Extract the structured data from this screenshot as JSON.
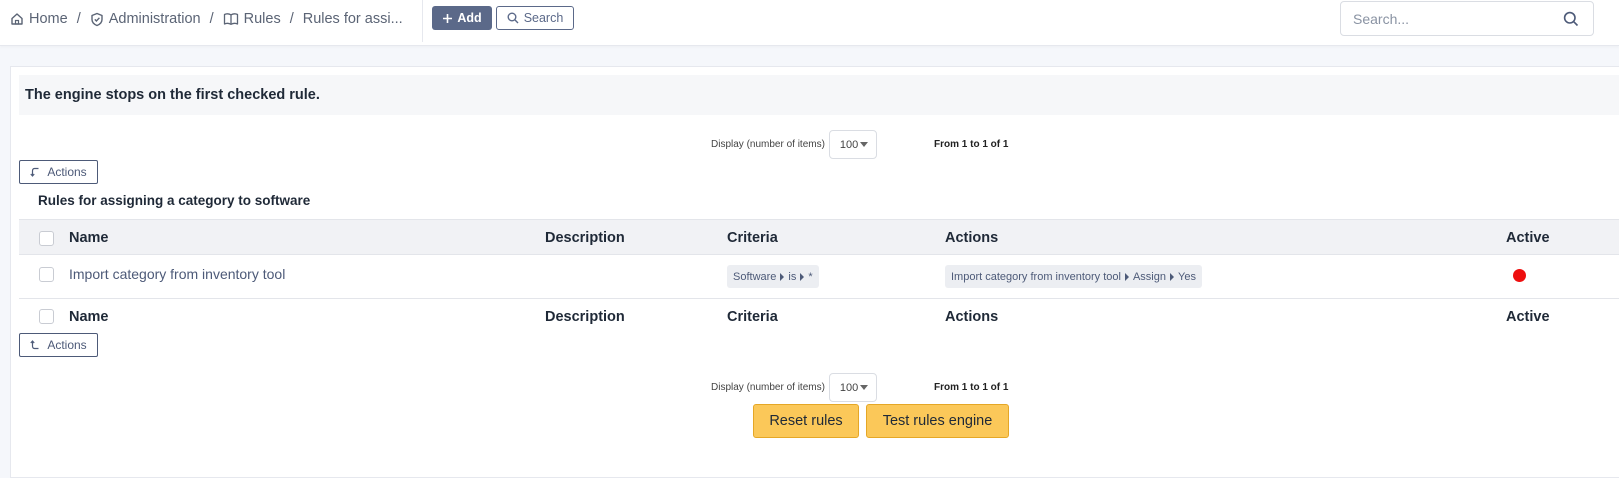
{
  "breadcrumb": {
    "home": "Home",
    "administration": "Administration",
    "rules": "Rules",
    "current": "Rules for assi..."
  },
  "toolbar": {
    "add_label": "Add",
    "search_label": "Search"
  },
  "global_search": {
    "placeholder": "Search..."
  },
  "banner": "The engine stops on the first checked rule.",
  "pager": {
    "display_label": "Display (number of items)",
    "per_page": "100",
    "from_text": "From 1 to 1 of 1"
  },
  "actions_label": "Actions",
  "table": {
    "title": "Rules for assigning a category to software",
    "columns": [
      "Name",
      "Description",
      "Criteria",
      "Actions",
      "Active"
    ],
    "rows": [
      {
        "name": "Import category from inventory tool",
        "description": "",
        "criteria": [
          "Software",
          "is",
          "*"
        ],
        "actions": [
          "Import category from inventory tool",
          "Assign",
          "Yes"
        ],
        "active_color": "#ee0f0f"
      }
    ]
  },
  "buttons": {
    "reset": "Reset rules",
    "test": "Test rules engine"
  },
  "colors": {
    "accent": "#5b6989",
    "warning_button": "#fbc859",
    "inactive_dot": "#ee0f0f"
  }
}
